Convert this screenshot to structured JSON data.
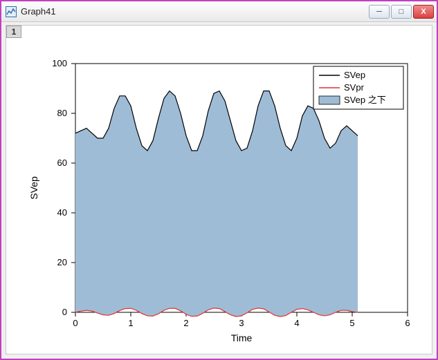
{
  "window": {
    "title": "Graph41",
    "icon_name": "graph-app-icon",
    "buttons": {
      "minimize": "─",
      "maximize": "□",
      "close": "X"
    },
    "tab_label": "1"
  },
  "chart_data": {
    "type": "area",
    "title": "",
    "xlabel": "Time",
    "ylabel": "SVep",
    "xlim": [
      0,
      6
    ],
    "ylim": [
      0,
      100
    ],
    "xticks": [
      0,
      1,
      2,
      3,
      4,
      5,
      6
    ],
    "yticks": [
      0,
      20,
      40,
      60,
      80,
      100
    ],
    "legend": {
      "entries": [
        "SVep",
        "SVpr",
        "SVep 之下"
      ],
      "position": "upper-right"
    },
    "series": [
      {
        "name": "SVep",
        "style": "line-black",
        "x": [
          0,
          0.1,
          0.2,
          0.3,
          0.4,
          0.5,
          0.6,
          0.7,
          0.8,
          0.9,
          1.0,
          1.1,
          1.2,
          1.3,
          1.4,
          1.5,
          1.6,
          1.7,
          1.8,
          1.9,
          2.0,
          2.1,
          2.2,
          2.3,
          2.4,
          2.5,
          2.6,
          2.7,
          2.8,
          2.9,
          3.0,
          3.1,
          3.2,
          3.3,
          3.4,
          3.5,
          3.6,
          3.7,
          3.8,
          3.9,
          4.0,
          4.1,
          4.2,
          4.3,
          4.4,
          4.5,
          4.6,
          4.7,
          4.8,
          4.9,
          5.0,
          5.1
        ],
        "y": [
          72,
          73,
          74,
          72,
          70,
          70,
          74,
          82,
          87,
          87,
          83,
          74,
          67,
          65,
          69,
          78,
          86,
          89,
          87,
          80,
          71,
          65,
          65,
          71,
          81,
          88,
          89,
          85,
          77,
          69,
          65,
          66,
          73,
          83,
          89,
          89,
          83,
          74,
          67,
          65,
          70,
          79,
          83,
          82,
          77,
          70,
          66,
          68,
          73,
          75,
          73,
          71
        ]
      },
      {
        "name": "SVpr",
        "style": "line-red",
        "x": [
          0,
          0.1,
          0.2,
          0.3,
          0.4,
          0.5,
          0.6,
          0.7,
          0.8,
          0.9,
          1.0,
          1.1,
          1.2,
          1.3,
          1.4,
          1.5,
          1.6,
          1.7,
          1.8,
          1.9,
          2.0,
          2.1,
          2.2,
          2.3,
          2.4,
          2.5,
          2.6,
          2.7,
          2.8,
          2.9,
          3.0,
          3.1,
          3.2,
          3.3,
          3.4,
          3.5,
          3.6,
          3.7,
          3.8,
          3.9,
          4.0,
          4.1,
          4.2,
          4.3,
          4.4,
          4.5,
          4.6,
          4.7,
          4.8,
          4.9,
          5.0,
          5.1
        ],
        "y": [
          0,
          0.5,
          0.8,
          0.5,
          -0.3,
          -1.0,
          -1.2,
          -0.5,
          0.7,
          1.5,
          1.6,
          0.8,
          -0.5,
          -1.4,
          -1.5,
          -0.6,
          0.8,
          1.6,
          1.6,
          0.6,
          -0.8,
          -1.6,
          -1.5,
          -0.4,
          1.0,
          1.7,
          1.5,
          0.3,
          -1.0,
          -1.7,
          -1.4,
          -0.2,
          1.2,
          1.7,
          1.4,
          0.1,
          -1.2,
          -1.7,
          -1.3,
          0.0,
          1.2,
          1.5,
          1.0,
          0.0,
          -1.0,
          -1.4,
          -1.0,
          0.0,
          0.8,
          0.8,
          0.3,
          0
        ]
      },
      {
        "name": "SVep 之下",
        "style": "area-blue",
        "description": "Filled area between SVep curve and SVpr curve (approximately SVep down to 0)."
      }
    ]
  }
}
